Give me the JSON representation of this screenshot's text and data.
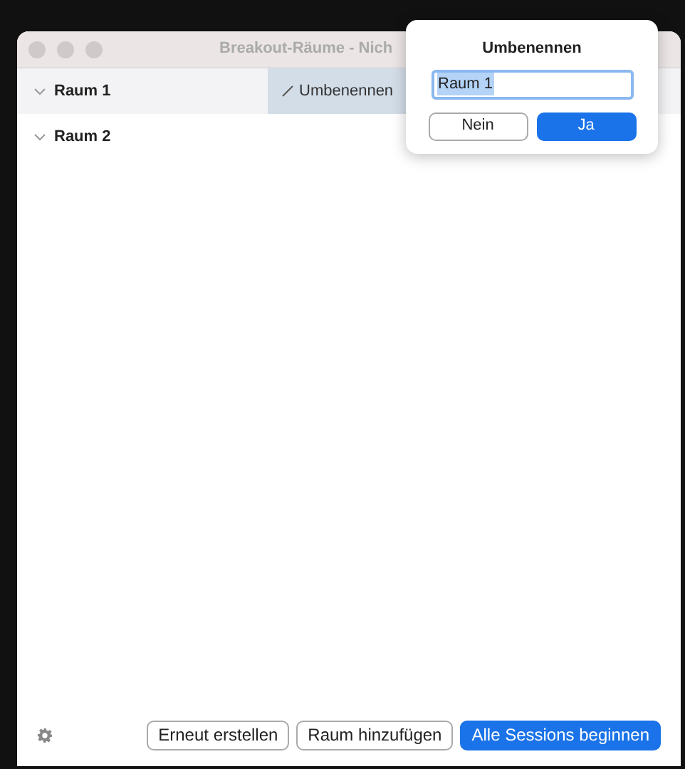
{
  "window": {
    "title": "Breakout-Räume - Nich"
  },
  "rooms": [
    {
      "name": "Raum 1",
      "hovered": true,
      "action": "Umbenennen"
    },
    {
      "name": "Raum 2",
      "hovered": false
    }
  ],
  "rename_popover": {
    "title": "Umbenennen",
    "value": "Raum 1",
    "buttons": [
      {
        "label": "Nein",
        "primary": false
      },
      {
        "label": "Ja",
        "primary": true
      }
    ]
  },
  "footer": {
    "buttons": [
      {
        "label": "Erneut erstellen",
        "primary": false
      },
      {
        "label": "Raum hinzufügen",
        "primary": false
      },
      {
        "label": "Alle Sessions beginnen",
        "primary": true
      }
    ]
  }
}
